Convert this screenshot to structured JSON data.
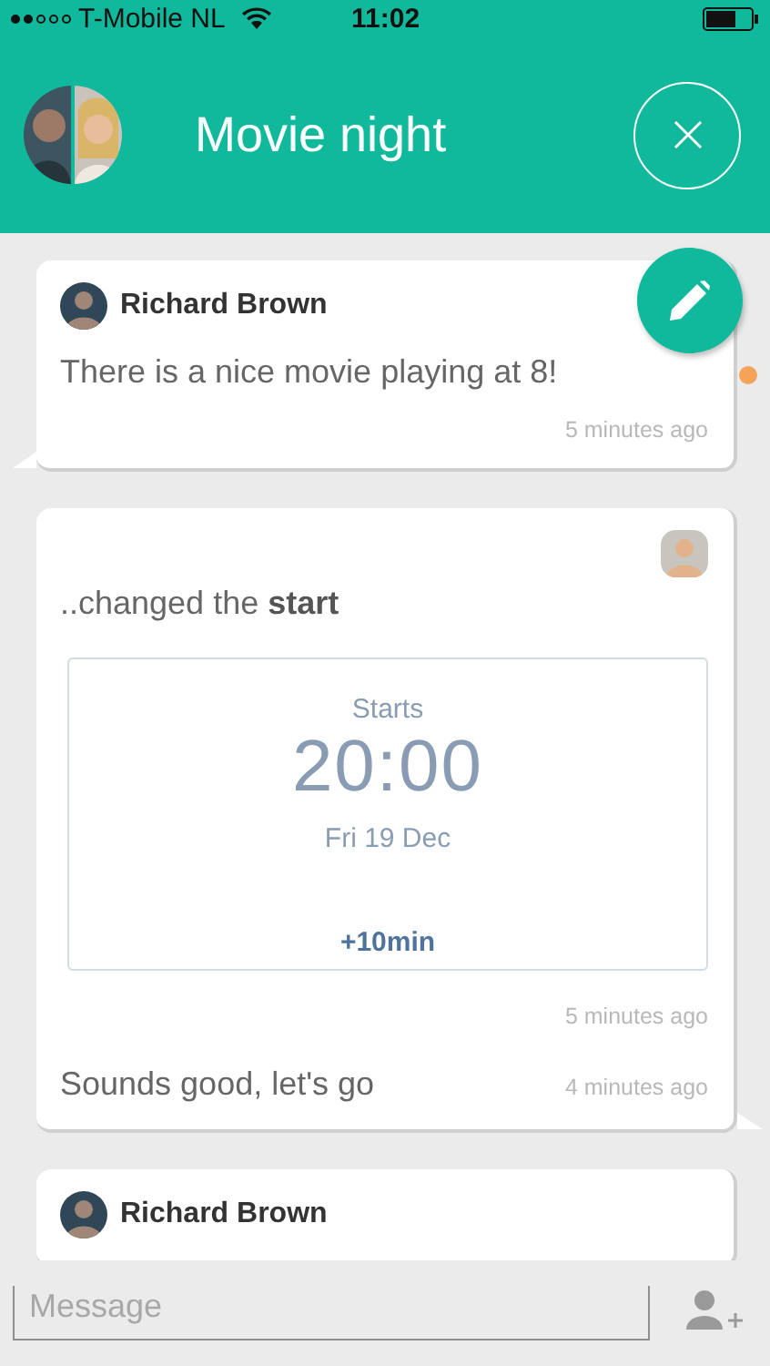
{
  "status_bar": {
    "carrier": "T-Mobile NL",
    "time": "11:02"
  },
  "header": {
    "title": "Movie night"
  },
  "messages": [
    {
      "kind": "text",
      "outgoing": false,
      "author": "Richard Brown",
      "text": "There is a nice movie playing at 8!",
      "time": "5 minutes ago",
      "unread": true
    },
    {
      "kind": "change",
      "outgoing": true,
      "text": "..changed the **start**",
      "event": {
        "label": "Starts",
        "time": "20:00",
        "date": "Fri 19 Dec",
        "action": "+10min"
      },
      "time": "5 minutes ago",
      "replies": [
        {
          "text": "Sounds good, let's go",
          "time": "4 minutes ago"
        }
      ]
    },
    {
      "kind": "text",
      "author": "Richard Brown"
    }
  ],
  "compose": {
    "placeholder": "Message"
  }
}
